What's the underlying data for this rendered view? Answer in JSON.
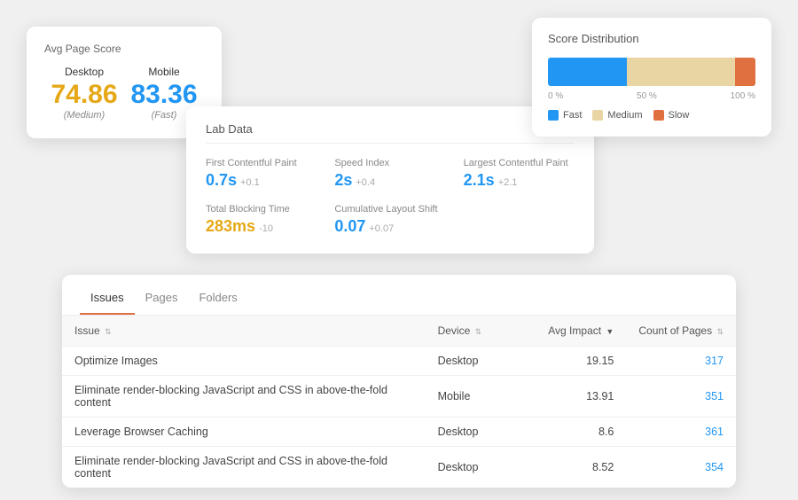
{
  "avgScore": {
    "title": "Avg Page Score",
    "desktop": {
      "label": "Desktop",
      "value": "74.86",
      "sub": "(Medium)"
    },
    "mobile": {
      "label": "Mobile",
      "value": "83.36",
      "sub": "(Fast)"
    }
  },
  "labData": {
    "title": "Lab Data",
    "metrics": [
      {
        "label": "First Contentful Paint",
        "value": "0.7s",
        "delta": "+0.1",
        "orange": false
      },
      {
        "label": "Speed Index",
        "value": "2s",
        "delta": "+0.4",
        "orange": false
      },
      {
        "label": "Largest Contentful Paint",
        "value": "2.1s",
        "delta": "+2.1",
        "orange": false
      },
      {
        "label": "Total Blocking Time",
        "value": "283ms",
        "delta": "-10",
        "orange": true
      },
      {
        "label": "Cumulative Layout Shift",
        "value": "0.07",
        "delta": "+0.07",
        "orange": false
      }
    ]
  },
  "scoreDist": {
    "title": "Score Distribution",
    "bars": [
      {
        "label": "Fast",
        "pct": 38,
        "color": "#2196F3"
      },
      {
        "label": "Medium",
        "pct": 52,
        "color": "#e8d5a3"
      },
      {
        "label": "Slow",
        "pct": 10,
        "color": "#e07040"
      }
    ],
    "axisLabels": [
      "0 %",
      "50 %",
      "100 %"
    ],
    "legend": [
      {
        "label": "Fast",
        "color": "#2196F3"
      },
      {
        "label": "Medium",
        "color": "#e8d5a3"
      },
      {
        "label": "Slow",
        "color": "#e07040"
      }
    ]
  },
  "issues": {
    "tabs": [
      {
        "label": "Issues",
        "active": true
      },
      {
        "label": "Pages",
        "active": false
      },
      {
        "label": "Folders",
        "active": false
      }
    ],
    "columns": [
      {
        "label": "Issue",
        "sortable": true
      },
      {
        "label": "Device",
        "sortable": true
      },
      {
        "label": "Avg Impact",
        "sortable": true,
        "sorted": true
      },
      {
        "label": "Count of Pages",
        "sortable": true
      }
    ],
    "rows": [
      {
        "issue": "Optimize Images",
        "device": "Desktop",
        "impact": "19.15",
        "pages": "317"
      },
      {
        "issue": "Eliminate render-blocking JavaScript and CSS in above-the-fold content",
        "device": "Mobile",
        "impact": "13.91",
        "pages": "351"
      },
      {
        "issue": "Leverage Browser Caching",
        "device": "Desktop",
        "impact": "8.6",
        "pages": "361"
      },
      {
        "issue": "Eliminate render-blocking JavaScript and CSS in above-the-fold content",
        "device": "Desktop",
        "impact": "8.52",
        "pages": "354"
      }
    ]
  }
}
